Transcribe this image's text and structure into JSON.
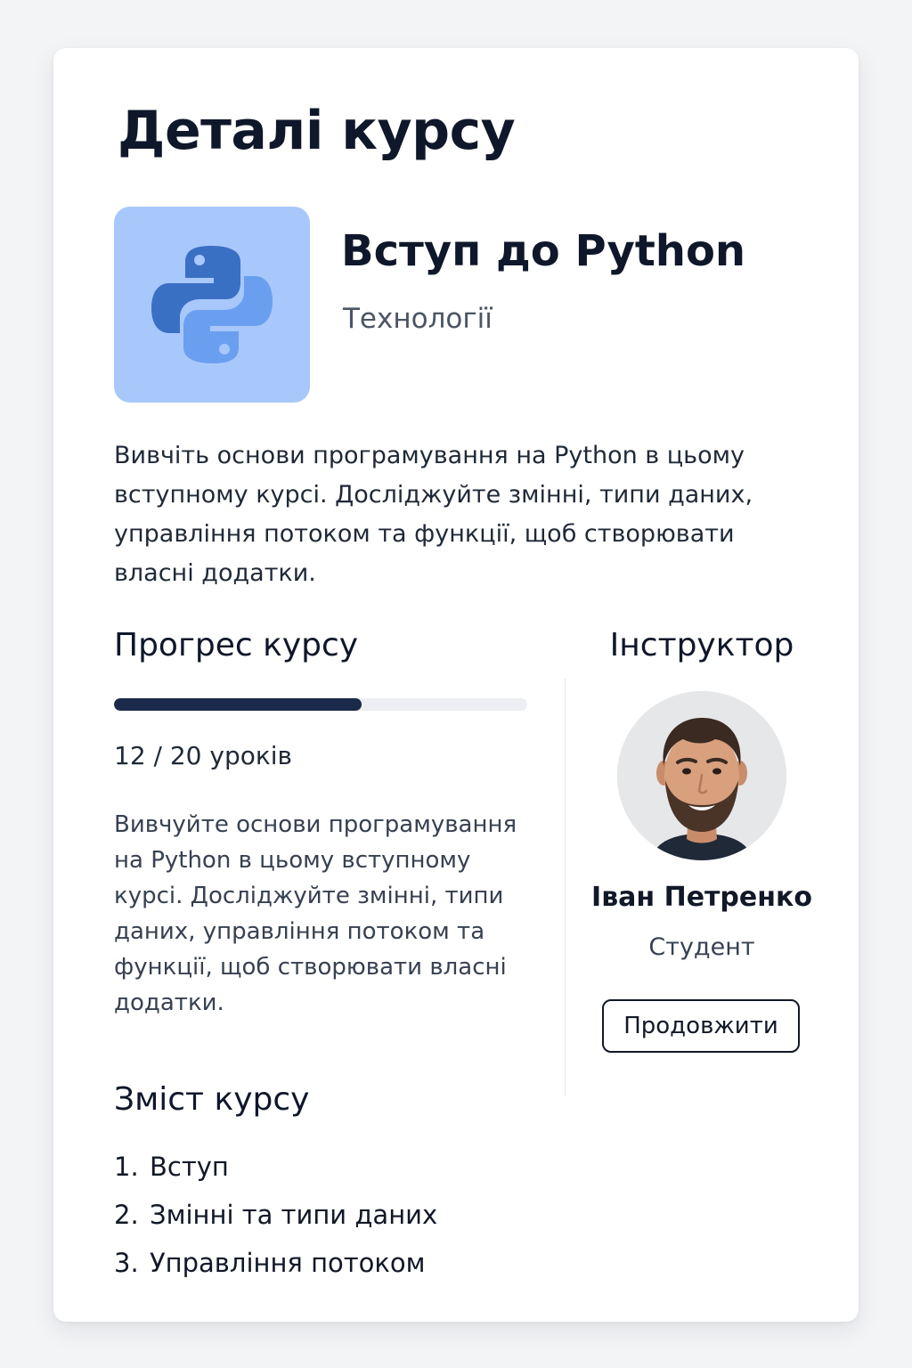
{
  "page": {
    "title": "Деталі курсу"
  },
  "course": {
    "name": "Вступ до Python",
    "category": "Технології",
    "icon": "python-logo-icon",
    "icon_bg_color": "#a8c8fb",
    "description": "Вивчіть основи програмування на Python в цьому вступному курсі. Досліджуйте змінні, типи даних, управління потоком та функції, щоб створювати власні додатки."
  },
  "progress": {
    "heading": "Прогрес курсу",
    "completed": 12,
    "total": 20,
    "fraction": 0.6,
    "lessons_label": "12 / 20 уроків",
    "bar_color": "#1b2a4a",
    "description": "Вивчуйте основи програмування на Python в цьому вступному курсі. Досліджуйте змінні, типи даних, управління потоком та функції, щоб створювати власні додатки."
  },
  "instructor": {
    "heading": "Інструктор",
    "name": "Іван Петренко",
    "role": "Студент",
    "avatar": "instructor-photo",
    "button_label": "Продовжити"
  },
  "contents": {
    "heading": "Зміст курсу",
    "items": [
      {
        "number": "1.",
        "title": "Вступ"
      },
      {
        "number": "2.",
        "title": "Змінні та типи даних"
      },
      {
        "number": "3.",
        "title": "Управління потоком"
      }
    ]
  }
}
